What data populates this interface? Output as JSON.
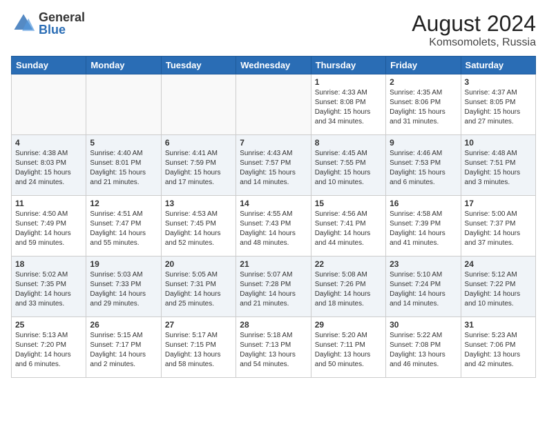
{
  "header": {
    "logo_general": "General",
    "logo_blue": "Blue",
    "month_year": "August 2024",
    "location": "Komsomolets, Russia"
  },
  "weekdays": [
    "Sunday",
    "Monday",
    "Tuesday",
    "Wednesday",
    "Thursday",
    "Friday",
    "Saturday"
  ],
  "weeks": [
    [
      {
        "day": "",
        "info": ""
      },
      {
        "day": "",
        "info": ""
      },
      {
        "day": "",
        "info": ""
      },
      {
        "day": "",
        "info": ""
      },
      {
        "day": "1",
        "info": "Sunrise: 4:33 AM\nSunset: 8:08 PM\nDaylight: 15 hours\nand 34 minutes."
      },
      {
        "day": "2",
        "info": "Sunrise: 4:35 AM\nSunset: 8:06 PM\nDaylight: 15 hours\nand 31 minutes."
      },
      {
        "day": "3",
        "info": "Sunrise: 4:37 AM\nSunset: 8:05 PM\nDaylight: 15 hours\nand 27 minutes."
      }
    ],
    [
      {
        "day": "4",
        "info": "Sunrise: 4:38 AM\nSunset: 8:03 PM\nDaylight: 15 hours\nand 24 minutes."
      },
      {
        "day": "5",
        "info": "Sunrise: 4:40 AM\nSunset: 8:01 PM\nDaylight: 15 hours\nand 21 minutes."
      },
      {
        "day": "6",
        "info": "Sunrise: 4:41 AM\nSunset: 7:59 PM\nDaylight: 15 hours\nand 17 minutes."
      },
      {
        "day": "7",
        "info": "Sunrise: 4:43 AM\nSunset: 7:57 PM\nDaylight: 15 hours\nand 14 minutes."
      },
      {
        "day": "8",
        "info": "Sunrise: 4:45 AM\nSunset: 7:55 PM\nDaylight: 15 hours\nand 10 minutes."
      },
      {
        "day": "9",
        "info": "Sunrise: 4:46 AM\nSunset: 7:53 PM\nDaylight: 15 hours\nand 6 minutes."
      },
      {
        "day": "10",
        "info": "Sunrise: 4:48 AM\nSunset: 7:51 PM\nDaylight: 15 hours\nand 3 minutes."
      }
    ],
    [
      {
        "day": "11",
        "info": "Sunrise: 4:50 AM\nSunset: 7:49 PM\nDaylight: 14 hours\nand 59 minutes."
      },
      {
        "day": "12",
        "info": "Sunrise: 4:51 AM\nSunset: 7:47 PM\nDaylight: 14 hours\nand 55 minutes."
      },
      {
        "day": "13",
        "info": "Sunrise: 4:53 AM\nSunset: 7:45 PM\nDaylight: 14 hours\nand 52 minutes."
      },
      {
        "day": "14",
        "info": "Sunrise: 4:55 AM\nSunset: 7:43 PM\nDaylight: 14 hours\nand 48 minutes."
      },
      {
        "day": "15",
        "info": "Sunrise: 4:56 AM\nSunset: 7:41 PM\nDaylight: 14 hours\nand 44 minutes."
      },
      {
        "day": "16",
        "info": "Sunrise: 4:58 AM\nSunset: 7:39 PM\nDaylight: 14 hours\nand 41 minutes."
      },
      {
        "day": "17",
        "info": "Sunrise: 5:00 AM\nSunset: 7:37 PM\nDaylight: 14 hours\nand 37 minutes."
      }
    ],
    [
      {
        "day": "18",
        "info": "Sunrise: 5:02 AM\nSunset: 7:35 PM\nDaylight: 14 hours\nand 33 minutes."
      },
      {
        "day": "19",
        "info": "Sunrise: 5:03 AM\nSunset: 7:33 PM\nDaylight: 14 hours\nand 29 minutes."
      },
      {
        "day": "20",
        "info": "Sunrise: 5:05 AM\nSunset: 7:31 PM\nDaylight: 14 hours\nand 25 minutes."
      },
      {
        "day": "21",
        "info": "Sunrise: 5:07 AM\nSunset: 7:28 PM\nDaylight: 14 hours\nand 21 minutes."
      },
      {
        "day": "22",
        "info": "Sunrise: 5:08 AM\nSunset: 7:26 PM\nDaylight: 14 hours\nand 18 minutes."
      },
      {
        "day": "23",
        "info": "Sunrise: 5:10 AM\nSunset: 7:24 PM\nDaylight: 14 hours\nand 14 minutes."
      },
      {
        "day": "24",
        "info": "Sunrise: 5:12 AM\nSunset: 7:22 PM\nDaylight: 14 hours\nand 10 minutes."
      }
    ],
    [
      {
        "day": "25",
        "info": "Sunrise: 5:13 AM\nSunset: 7:20 PM\nDaylight: 14 hours\nand 6 minutes."
      },
      {
        "day": "26",
        "info": "Sunrise: 5:15 AM\nSunset: 7:17 PM\nDaylight: 14 hours\nand 2 minutes."
      },
      {
        "day": "27",
        "info": "Sunrise: 5:17 AM\nSunset: 7:15 PM\nDaylight: 13 hours\nand 58 minutes."
      },
      {
        "day": "28",
        "info": "Sunrise: 5:18 AM\nSunset: 7:13 PM\nDaylight: 13 hours\nand 54 minutes."
      },
      {
        "day": "29",
        "info": "Sunrise: 5:20 AM\nSunset: 7:11 PM\nDaylight: 13 hours\nand 50 minutes."
      },
      {
        "day": "30",
        "info": "Sunrise: 5:22 AM\nSunset: 7:08 PM\nDaylight: 13 hours\nand 46 minutes."
      },
      {
        "day": "31",
        "info": "Sunrise: 5:23 AM\nSunset: 7:06 PM\nDaylight: 13 hours\nand 42 minutes."
      }
    ]
  ]
}
